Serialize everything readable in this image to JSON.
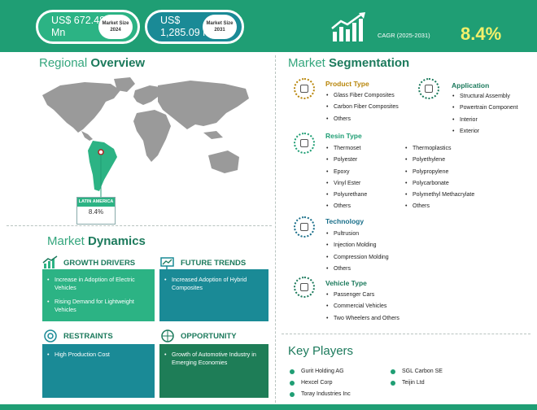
{
  "header": {
    "value_2024": "US$ 672.48 Mn",
    "badge_2024": "Market Size 2024",
    "value_2031": "US$ 1,285.09 Mn",
    "badge_2031": "Market Size 2031",
    "cagr_label": "CAGR (2025-2031)",
    "cagr_value": "8.4%",
    "growth_icon": "growth-chart-icon"
  },
  "regional": {
    "title_a": "Regional",
    "title_b": "Overview",
    "map_icon": "world-map",
    "highlight_region": "LATIN AMERICA",
    "highlight_value": "8.4%"
  },
  "dynamics": {
    "title_a": "Market",
    "title_b": "Dynamics",
    "growth_drivers": {
      "title": "GROWTH DRIVERS",
      "items": [
        "Increase in Adoption of Electric Vehicles",
        "Rising Demand for Lightweight Vehicles"
      ]
    },
    "future_trends": {
      "title": "FUTURE TRENDS",
      "items": [
        "Increased Adoption of Hybrid Composites"
      ]
    },
    "restraints": {
      "title": "RESTRAINTS",
      "items": [
        "High Production Cost"
      ]
    },
    "opportunity": {
      "title": "OPPORTUNITY",
      "items": [
        "Growth of Automotive Industry in Emerging Economies"
      ]
    }
  },
  "segmentation": {
    "title_a": "Market",
    "title_b": "Segmentation",
    "product_type": {
      "title": "Product Type",
      "items": [
        "Glass Fiber Composites",
        "Carbon Fiber Composites",
        "Others"
      ]
    },
    "application": {
      "title": "Application",
      "items": [
        "Structural Assembly",
        "Powertrain Component",
        "Interior",
        "Exterior"
      ]
    },
    "resin_type": {
      "title": "Resin Type",
      "items_left": [
        "Thermoset",
        "Polyester",
        "Epoxy",
        "Vinyl Ester",
        "Polyurethane",
        "Others"
      ],
      "items_right": [
        "Thermoplastics",
        "Polyethylene",
        "Polypropylene",
        "Polycarbonate",
        "Polymethyl Methacrylate",
        "Others"
      ]
    },
    "technology": {
      "title": "Technology",
      "items": [
        "Pultrusion",
        "Injection Molding",
        "Compression Molding",
        "Others"
      ]
    },
    "vehicle_type": {
      "title": "Vehicle Type",
      "items": [
        "Passenger Cars",
        "Commercial Vehicles",
        "Two Wheelers and Others"
      ]
    }
  },
  "key_players": {
    "title": "Key Players",
    "left": [
      "Gurit Holding AG",
      "Hexcel Corp",
      "Toray Industries Inc"
    ],
    "right": [
      "SGL Carbon SE",
      "Teijin Ltd"
    ]
  },
  "colors": {
    "primary_green": "#1f9e74",
    "teal": "#1a8a96",
    "cagr_yellow": "#f3f06a",
    "product_type": "#b8860b",
    "resin_type": "#1f9e74",
    "technology": "#1a6f8a",
    "vehicle_type": "#1c7a5c"
  }
}
